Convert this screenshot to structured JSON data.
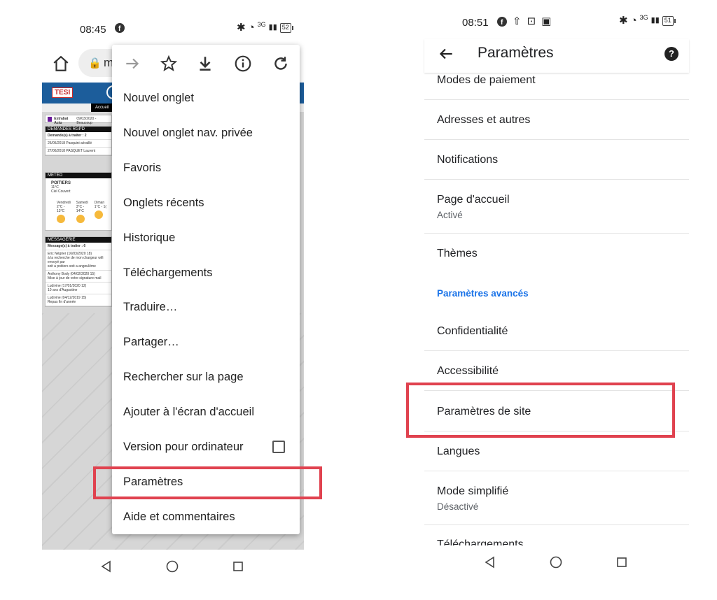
{
  "left": {
    "statusbar": {
      "time": "08:45",
      "network": "3G",
      "battery": "52"
    },
    "browser": {
      "url_text": "m"
    },
    "webpage": {
      "logo": "TESI",
      "nav_tab": "Accueil",
      "actu": {
        "title": "Extrabat Actu",
        "text": "09/03/2020 - Beaucoup"
      },
      "rgpd": {
        "header": "DEMANDES RGPD",
        "count": "Demande(s) à traiter : 2",
        "rows": [
          "25/05/2018   Pasquini aéraillé",
          "27/06/2018   PASQUET Laurent"
        ]
      },
      "meteo": {
        "header": "MÉTÉO",
        "city": "POITIERS",
        "temp": "11°C",
        "cond": "Ciel Couvert",
        "days": [
          "Vendredi",
          "Samedi",
          "Diman"
        ],
        "ranges": [
          "2°C - 13°C",
          "3°C - 14°C",
          "1°C - 1("
        ]
      },
      "messagerie": {
        "header": "MESSAGERIE",
        "count": "Message(s) à traiter : 6",
        "rows": [
          "Eric Négrier (16/03/2020 18)",
          "à la recherche de mon chargeur wifi envoyé par",
          "soit a poitiers soit a angoulême",
          "Anthony Body (04/02/2020 15)",
          "Mise à jour de votre signature mail",
          "Ludivine (17/01/2020 12)",
          "10 ans d'Augustine",
          "Ludivine (04/12/2019 15)",
          "Repas fin d'année"
        ]
      }
    },
    "menu": {
      "toolbar": [
        "forward-icon",
        "star-icon",
        "download-icon",
        "info-icon",
        "refresh-icon"
      ],
      "items": [
        "Nouvel onglet",
        "Nouvel onglet nav. privée",
        "Favoris",
        "Onglets récents",
        "Historique",
        "Téléchargements",
        "Traduire…",
        "Partager…",
        "Rechercher sur la page",
        "Ajouter à l'écran d'accueil",
        "Version pour ordinateur",
        "Paramètres",
        "Aide et commentaires"
      ]
    },
    "highlight_color": "#e0424f"
  },
  "right": {
    "statusbar": {
      "time": "08:51",
      "network": "3G",
      "battery": "51"
    },
    "appbar": {
      "title": "Paramètres"
    },
    "settings": {
      "items": [
        {
          "label": "Modes de paiement"
        },
        {
          "label": "Adresses et autres"
        },
        {
          "label": "Notifications"
        },
        {
          "label": "Page d'accueil",
          "sub": "Activé"
        },
        {
          "label": "Thèmes"
        },
        {
          "section": "Paramètres avancés"
        },
        {
          "label": "Confidentialité"
        },
        {
          "label": "Accessibilité"
        },
        {
          "label": "Paramètres de site"
        },
        {
          "label": "Langues"
        },
        {
          "label": "Mode simplifié",
          "sub": "Désactivé"
        },
        {
          "label": "Téléchargements"
        }
      ]
    },
    "accent_color": "#1a73e8"
  }
}
